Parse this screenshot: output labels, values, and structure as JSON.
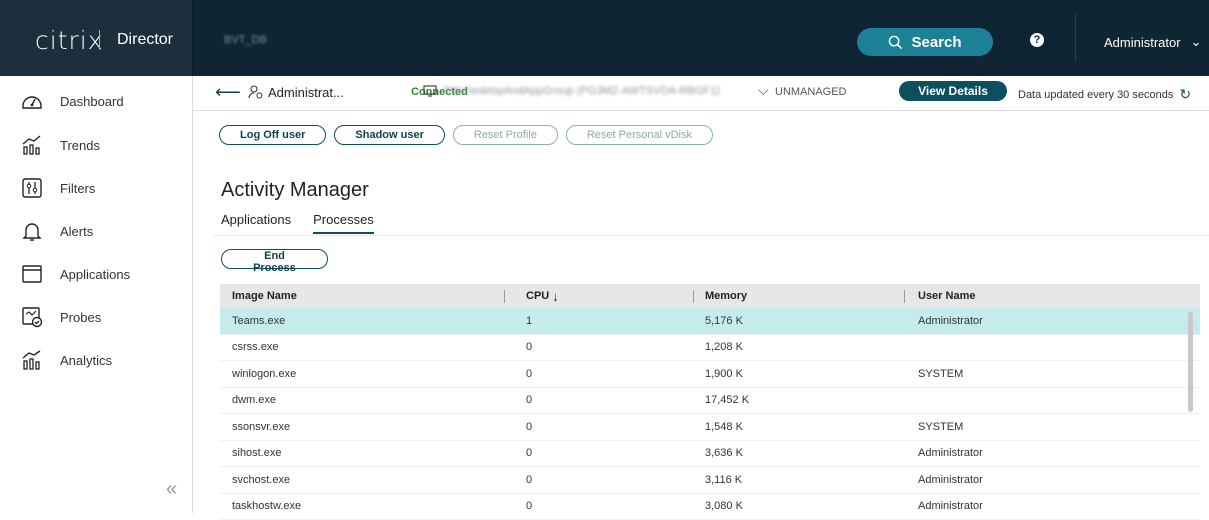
{
  "topbar": {
    "logo": "citrix",
    "product": "Director",
    "site_name": "BVT_DB",
    "search_label": "Search",
    "help_icon": "help-icon",
    "user_label": "Administrator"
  },
  "sidebar": {
    "items": [
      {
        "label": "Dashboard",
        "icon": "dashboard-icon"
      },
      {
        "label": "Trends",
        "icon": "trends-icon"
      },
      {
        "label": "Filters",
        "icon": "filters-icon"
      },
      {
        "label": "Alerts",
        "icon": "bell-icon"
      },
      {
        "label": "Applications",
        "icon": "window-icon"
      },
      {
        "label": "Probes",
        "icon": "probes-icon"
      },
      {
        "label": "Analytics",
        "icon": "analytics-icon"
      }
    ],
    "collapse_glyph": "«"
  },
  "context": {
    "user": "Administrat...",
    "status": "Connected",
    "machine": "RdsDesktopAndAppGroup (PG3MZ-AWTSVDA-RBGF1)",
    "management": "UNMANAGED",
    "view_details_label": "View Details",
    "updated_text": "Data updated every 30 seconds"
  },
  "actions": {
    "log_off": "Log Off user",
    "shadow": "Shadow user",
    "reset_profile": "Reset Profile",
    "reset_vdisk": "Reset Personal vDisk"
  },
  "page": {
    "title": "Activity Manager",
    "tabs": [
      "Applications",
      "Processes"
    ],
    "active_tab": "Processes",
    "end_process_label": "End Process"
  },
  "table": {
    "columns": [
      "Image Name",
      "CPU",
      "Memory",
      "User Name"
    ],
    "sort_indicator": "↓",
    "rows": [
      {
        "name": "Teams.exe",
        "cpu": "1",
        "memory": "5,176 K",
        "user": "Administrator"
      },
      {
        "name": "csrss.exe",
        "cpu": "0",
        "memory": "1,208 K",
        "user": ""
      },
      {
        "name": "winlogon.exe",
        "cpu": "0",
        "memory": "1,900 K",
        "user": "SYSTEM"
      },
      {
        "name": "dwm.exe",
        "cpu": "0",
        "memory": "17,452 K",
        "user": ""
      },
      {
        "name": "ssonsvr.exe",
        "cpu": "0",
        "memory": "1,548 K",
        "user": "SYSTEM"
      },
      {
        "name": "sihost.exe",
        "cpu": "0",
        "memory": "3,636 K",
        "user": "Administrator"
      },
      {
        "name": "svchost.exe",
        "cpu": "0",
        "memory": "3,116 K",
        "user": "Administrator"
      },
      {
        "name": "taskhostw.exe",
        "cpu": "0",
        "memory": "3,080 K",
        "user": "Administrator"
      }
    ]
  },
  "colors": {
    "topbar": "#102533",
    "accent": "#0e4f5f",
    "search": "#1c8196",
    "selected_row": "#c5ecec",
    "connected": "#2e8a2e"
  }
}
